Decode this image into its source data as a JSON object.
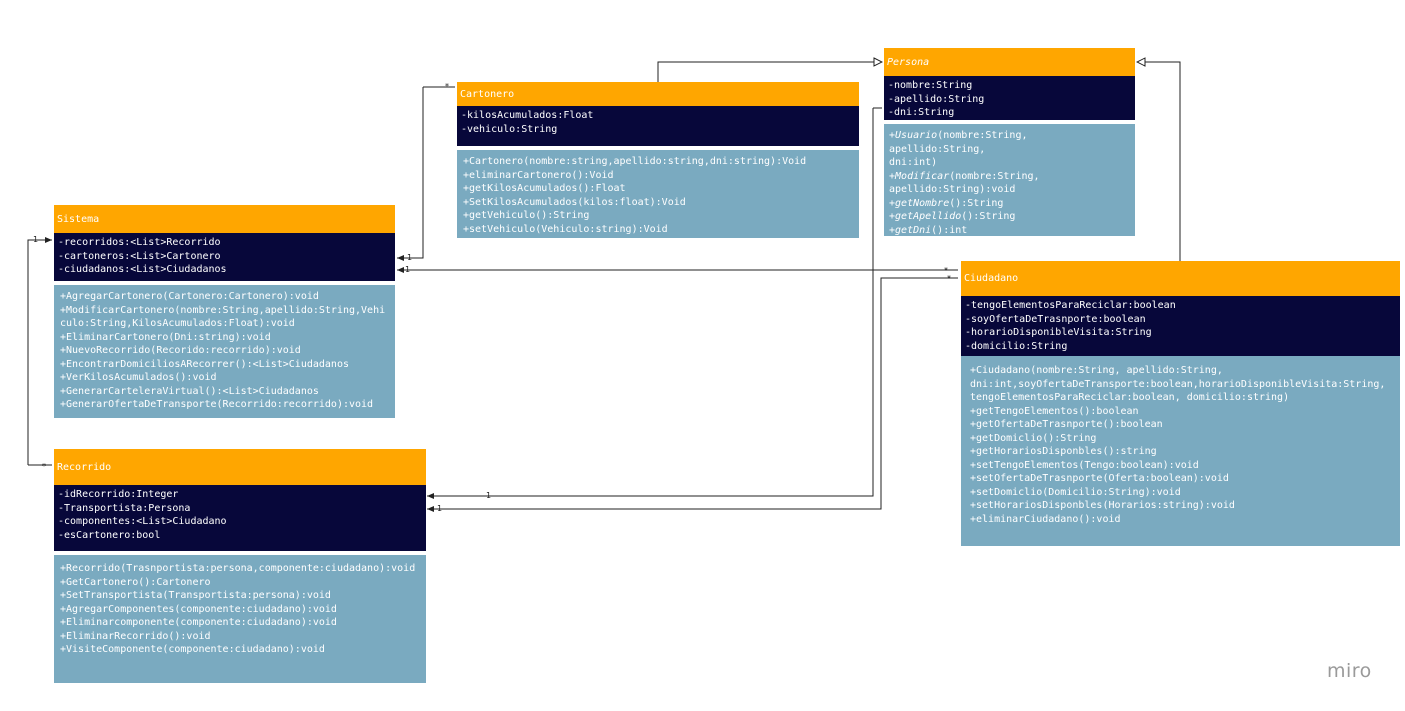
{
  "diagram": {
    "classes": {
      "sistema": {
        "name": "Sistema",
        "attributes": [
          "-recorridos:<List>Recorrido",
          "-cartoneros:<List>Cartonero",
          "-ciudadanos:<List>Ciudadanos"
        ],
        "methods": [
          "+AgregarCartonero(Cartonero:Cartonero):void",
          "+ModificarCartonero(nombre:String,apellido:String,Vehiculo:String,KilosAcumulados:Float):void",
          "+EliminarCartonero(Dni:string):void",
          "+NuevoRecorrido(Recorido:recorrido):void",
          "+EncontrarDomiciliosARecorrer():<List>Ciudadanos",
          "+VerKilosAcumulados():void",
          "+GenerarCarteleraVirtual():<List>Ciudadanos",
          "+GenerarOfertaDeTransporte(Recorrido:recorrido):void"
        ]
      },
      "cartonero": {
        "name": "Cartonero",
        "attributes": [
          "-kilosAcumulados:Float",
          "-vehiculo:String"
        ],
        "methods": [
          "+Cartonero(nombre:string,apellido:string,dni:string):Void",
          "+eliminarCartonero():Void",
          "+getKilosAcumulados():Float",
          "+SetKilosAcumulados(kilos:float):Void",
          "+getVehiculo():String",
          "+setVehiculo(Vehiculo:string):Void"
        ]
      },
      "persona": {
        "name": "Persona",
        "attributes": [
          "-nombre:String",
          "-apellido:String",
          "-dni:String"
        ],
        "methods": [
          {
            "name": "Usuario",
            "params": "(nombre:String, apellido:String, dni:int)"
          },
          {
            "name": "Modificar",
            "params": "(nombre:String, apellido:String):void"
          },
          {
            "name": "getNombre",
            "params": "():String"
          },
          {
            "name": "getApellido",
            "params": "():String"
          },
          {
            "name": "getDni",
            "params": "():int"
          }
        ]
      },
      "ciudadano": {
        "name": "Ciudadano",
        "attributes": [
          "-tengoElementosParaReciclar:boolean",
          "-soyOfertaDeTrasnporte:boolean",
          "-horarioDisponibleVisita:String",
          "-domicilio:String"
        ],
        "methods": [
          "+Ciudadano(nombre:String, apellido:String, dni:int,soyOfertaDeTransporte:boolean,horarioDisponibleVisita:String, tengoElementosParaReciclar:boolean, domicilio:string)",
          "+getTengoElementos():boolean",
          "+getOfertaDeTrasnporte():boolean",
          "+getDomiclio():String",
          "+getHorariosDisponbles():string",
          "+setTengoElementos(Tengo:boolean):void",
          "+setOfertaDeTrasnporte(Oferta:boolean):void",
          "+setDomiclio(Domicilio:String):void",
          "+setHorariosDisponbles(Horarios:string):void",
          "+eliminarCiudadano():void"
        ]
      },
      "recorrido": {
        "name": "Recorrido",
        "attributes": [
          "-idRecorrido:Integer",
          "-Transportista:Persona",
          "-componentes:<List>Ciudadano",
          "-esCartonero:bool"
        ],
        "methods": [
          "+Recorrido(Trasnportista:persona,componente:ciudadano):void",
          "+GetCartonero():Cartonero",
          "+SetTransportista(Transportista:persona):void",
          "+AgregarComponentes(componente:ciudadano):void",
          "+Eliminarcomponente(componente:ciudadano):void",
          "+EliminarRecorrido():void",
          "+VisiteComponente(componente:ciudadano):void"
        ]
      }
    },
    "multiplicities": {
      "sistema_recorrido_one": "1",
      "recorrido_many": "*",
      "cartonero_many": "*",
      "sistema_cartonero_one": "1",
      "sistema_ciudadano_one": "1",
      "ciudadano_many_a": "*",
      "ciudadano_many_b": "*",
      "recorrido_one_a": "1",
      "recorrido_one_b": "1"
    },
    "colors": {
      "header": "#ffa600",
      "attributes": "#07073a",
      "methods": "#7aaac0",
      "line": "#222222"
    }
  },
  "branding": {
    "logo": "miro"
  }
}
